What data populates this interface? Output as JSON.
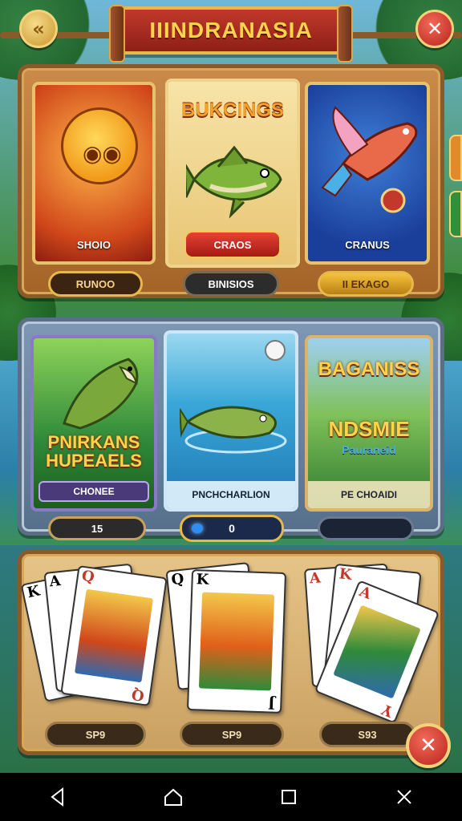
{
  "header": {
    "title": "IIINDRANASIA",
    "back_icon": "«",
    "close_icon": "✕"
  },
  "row1": {
    "cards": [
      {
        "label": "SHOIO"
      },
      {
        "heading": "BUKCINGS",
        "button_label": "CRAOS"
      },
      {
        "label": "CRANUS"
      }
    ],
    "values": [
      "RUNOO",
      "BINISIOS",
      "II EKAGO"
    ]
  },
  "row2": {
    "cards": [
      {
        "promo_line1": "PNIRKANS",
        "promo_line2": "HUPEAELS",
        "label": "CHONEE"
      },
      {
        "label": "PNCHCHARLION"
      },
      {
        "promo_line1": "BAGANISS",
        "promo_line2": "NDSMIE",
        "promo_line3": "Pauraneid",
        "label": "PE CHOAIDI"
      }
    ],
    "values": [
      "15",
      "0",
      ""
    ]
  },
  "row3": {
    "values": [
      "SP9",
      "SP9",
      "S93"
    ],
    "hands": [
      {
        "ranks": [
          "K",
          "A",
          "Q"
        ],
        "corner": "Q"
      },
      {
        "ranks": [
          "Q",
          "K"
        ],
        "corner": "J"
      },
      {
        "ranks": [
          "A",
          "K",
          "A"
        ],
        "corner": "Y"
      }
    ]
  },
  "bottom_close_icon": "✕",
  "colors": {
    "wood": "#8a5a2b",
    "gold": "#e8b84a",
    "red_button": "#c0392b"
  }
}
